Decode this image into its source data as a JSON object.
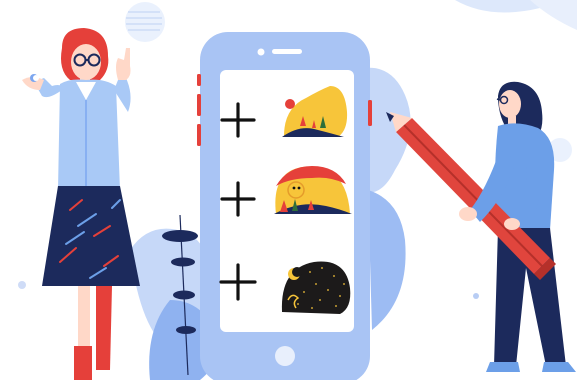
{
  "phone": {
    "rows": [
      {
        "add_icon": "plus-icon",
        "thumb_icon": "sunny-hill-icon"
      },
      {
        "add_icon": "plus-icon",
        "thumb_icon": "sunset-bird-icon"
      },
      {
        "add_icon": "plus-icon",
        "thumb_icon": "night-moon-icon"
      }
    ]
  },
  "colors": {
    "phone_body": "#a9c4f4",
    "phone_screen": "#ffffff",
    "accent_blue": "#7da7f0",
    "accent_red": "#e5403a",
    "navy": "#1c2a5c",
    "yellow": "#f7c53a",
    "shirt_blue": "#6c9fe8",
    "pencil_red": "#e0453d"
  }
}
